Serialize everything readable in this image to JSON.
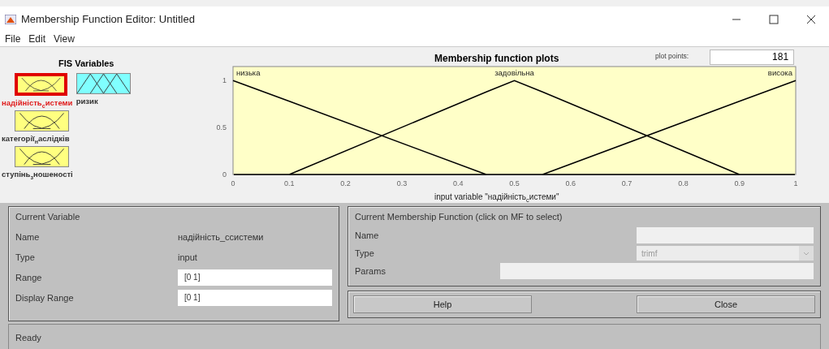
{
  "window": {
    "title": "Membership Function Editor: Untitled"
  },
  "menu": [
    "File",
    "Edit",
    "View"
  ],
  "fis_variables": {
    "title": "FIS Variables",
    "items": [
      {
        "label": "надійність$_{с}$истеми",
        "kind": "input",
        "selected": true
      },
      {
        "label": "ризик",
        "kind": "output",
        "selected": false
      },
      {
        "label": "категорії$_{н}$аслідків",
        "kind": "input",
        "selected": false
      },
      {
        "label": "ступінь$_{з}$ношеності",
        "kind": "input",
        "selected": false
      }
    ]
  },
  "plot": {
    "plot_points_label": "plot points:",
    "plot_points": "181",
    "chart_data": {
      "type": "line",
      "title": "Membership function plots",
      "xlabel": "input variable \"надійність$_{с}$истеми\"",
      "x": [
        0,
        0.1,
        0.45,
        0.5,
        0.55,
        0.9,
        1
      ],
      "series": [
        {
          "name": "низька",
          "color": "#000000",
          "values": [
            1,
            0.78,
            0,
            null,
            null,
            null,
            null
          ]
        },
        {
          "name": "задовільна",
          "color": "#000000",
          "values": [
            null,
            0,
            0.88,
            1,
            0.88,
            0,
            null
          ]
        },
        {
          "name": "висока",
          "color": "#000000",
          "values": [
            null,
            null,
            null,
            null,
            0,
            0.78,
            1
          ]
        }
      ],
      "xlim": [
        0,
        1
      ],
      "ylim": [
        0,
        1.15
      ],
      "xticks": [
        0,
        0.1,
        0.2,
        0.3,
        0.4,
        0.5,
        0.6,
        0.7,
        0.8,
        0.9,
        1
      ],
      "yticks": [
        0,
        0.5,
        1
      ]
    }
  },
  "current_variable": {
    "title": "Current Variable",
    "name_label": "Name",
    "name": "надійність_ссистеми",
    "type_label": "Type",
    "type": "input",
    "range_label": "Range",
    "range": "[0 1]",
    "display_range_label": "Display Range",
    "display_range": "[0 1]"
  },
  "current_mf": {
    "title": "Current Membership Function (click on MF to select)",
    "name_label": "Name",
    "type_label": "Type",
    "type": "trimf",
    "type_disabled": true,
    "params_label": "Params"
  },
  "buttons": [
    "Help",
    "Close"
  ],
  "status": "Ready"
}
